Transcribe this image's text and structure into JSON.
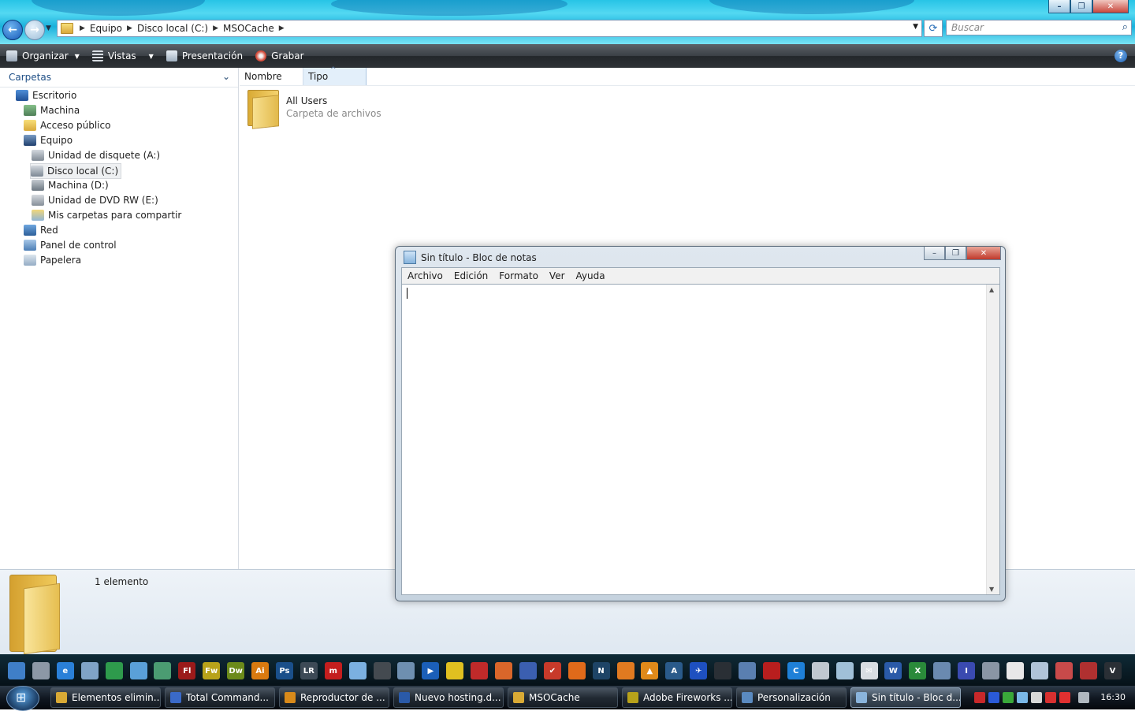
{
  "explorer": {
    "breadcrumb": [
      "Equipo",
      "Disco local (C:)",
      "MSOCache"
    ],
    "search_placeholder": "Buscar",
    "toolbar": {
      "organize": "Organizar",
      "views": "Vistas",
      "slideshow": "Presentación",
      "burn": "Grabar"
    },
    "folders_header": "Carpetas",
    "tree": [
      {
        "label": "Escritorio",
        "icon": "desktop-icon"
      },
      {
        "label": "Machina",
        "icon": "user-folder-icon"
      },
      {
        "label": "Acceso público",
        "icon": "folder-icon"
      },
      {
        "label": "Equipo",
        "icon": "computer-icon"
      },
      {
        "label": "Unidad de disquete (A:)",
        "icon": "floppy-drive-icon"
      },
      {
        "label": "Disco local (C:)",
        "icon": "hard-drive-icon",
        "selected": true
      },
      {
        "label": "Machina (D:)",
        "icon": "hard-drive-icon"
      },
      {
        "label": "Unidad de DVD RW (E:)",
        "icon": "dvd-drive-icon"
      },
      {
        "label": "Mis carpetas para compartir",
        "icon": "shared-folder-icon"
      },
      {
        "label": "Red",
        "icon": "network-icon"
      },
      {
        "label": "Panel de control",
        "icon": "control-panel-icon"
      },
      {
        "label": "Papelera",
        "icon": "recycle-bin-icon"
      }
    ],
    "columns": {
      "name": "Nombre",
      "type": "Tipo"
    },
    "items": [
      {
        "name": "All Users",
        "type": "Carpeta de archivos"
      }
    ],
    "status": "1 elemento"
  },
  "notepad": {
    "title": "Sin título - Bloc de notas",
    "menu": [
      "Archivo",
      "Edición",
      "Formato",
      "Ver",
      "Ayuda"
    ],
    "content": ""
  },
  "dock_icons": [
    {
      "name": "desktop-icon",
      "glyph": "",
      "color": "#3f7fc8"
    },
    {
      "name": "monitor-icon",
      "glyph": "",
      "color": "#8c98a6"
    },
    {
      "name": "internet-explorer-icon",
      "glyph": "e",
      "color": "#2a80d8"
    },
    {
      "name": "home-icon",
      "glyph": "",
      "color": "#7fa3c6"
    },
    {
      "name": "app-icon",
      "glyph": "",
      "color": "#2e9b4c"
    },
    {
      "name": "users-icon",
      "glyph": "",
      "color": "#5aa0d8"
    },
    {
      "name": "window-icon",
      "glyph": "",
      "color": "#4b9c72"
    },
    {
      "name": "flash-icon",
      "glyph": "Fl",
      "color": "#9b1a1a"
    },
    {
      "name": "fireworks-icon",
      "glyph": "Fw",
      "color": "#b8a21a"
    },
    {
      "name": "dreamweaver-icon",
      "glyph": "Dw",
      "color": "#6b8a1a"
    },
    {
      "name": "illustrator-icon",
      "glyph": "Ai",
      "color": "#d97a10"
    },
    {
      "name": "photoshop-icon",
      "glyph": "Ps",
      "color": "#1a4f8a"
    },
    {
      "name": "lightroom-icon",
      "glyph": "LR",
      "color": "#3d4a56"
    },
    {
      "name": "media-icon",
      "glyph": "m",
      "color": "#c41e1e"
    },
    {
      "name": "itunes-icon",
      "glyph": "",
      "color": "#7bb0e0"
    },
    {
      "name": "phone-icon",
      "glyph": "",
      "color": "#444a50"
    },
    {
      "name": "tools-icon",
      "glyph": "",
      "color": "#6e8fb0"
    },
    {
      "name": "player-icon",
      "glyph": "▶",
      "color": "#1b5fb8"
    },
    {
      "name": "norton-icon",
      "glyph": "",
      "color": "#e0c020"
    },
    {
      "name": "books-icon",
      "glyph": "",
      "color": "#c02a2a"
    },
    {
      "name": "cake-icon",
      "glyph": "",
      "color": "#d9662a"
    },
    {
      "name": "save-icon",
      "glyph": "",
      "color": "#3b5fb0"
    },
    {
      "name": "check-icon",
      "glyph": "✔",
      "color": "#c83a2a"
    },
    {
      "name": "firefox-icon",
      "glyph": "",
      "color": "#e06a1a"
    },
    {
      "name": "nero-icon",
      "glyph": "N",
      "color": "#1e4466"
    },
    {
      "name": "basketball-icon",
      "glyph": "",
      "color": "#e07a20"
    },
    {
      "name": "vlc-icon",
      "glyph": "▲",
      "color": "#e08a1a"
    },
    {
      "name": "a-icon",
      "glyph": "A",
      "color": "#2a5a8a"
    },
    {
      "name": "plane-icon",
      "glyph": "✈",
      "color": "#1e50c0"
    },
    {
      "name": "camera-icon",
      "glyph": "",
      "color": "#2a2f35"
    },
    {
      "name": "bars-icon",
      "glyph": "",
      "color": "#5a7fb0"
    },
    {
      "name": "acrobat-icon",
      "glyph": "",
      "color": "#b81e1e"
    },
    {
      "name": "c-icon",
      "glyph": "C",
      "color": "#1e80d8"
    },
    {
      "name": "card-icon",
      "glyph": "",
      "color": "#c0c8d0"
    },
    {
      "name": "paper-icon",
      "glyph": "",
      "color": "#a0c0d8"
    },
    {
      "name": "mail-icon",
      "glyph": "✉",
      "color": "#d8dde2"
    },
    {
      "name": "word-icon",
      "glyph": "W",
      "color": "#2a5aa8"
    },
    {
      "name": "excel-icon",
      "glyph": "X",
      "color": "#2a8a3a"
    },
    {
      "name": "photo-icon",
      "glyph": "",
      "color": "#6a8ab0"
    },
    {
      "name": "i-icon",
      "glyph": "I",
      "color": "#3a4ab0"
    },
    {
      "name": "pen-icon",
      "glyph": "",
      "color": "#8a96a4"
    },
    {
      "name": "cat-icon",
      "glyph": "",
      "color": "#e8e8e8"
    },
    {
      "name": "globe-icon",
      "glyph": "",
      "color": "#b0c4d8"
    },
    {
      "name": "cube-icon",
      "glyph": "",
      "color": "#c84a4a"
    },
    {
      "name": "ball-icon",
      "glyph": "",
      "color": "#b03030"
    },
    {
      "name": "v-icon",
      "glyph": "V",
      "color": "#2a2f35"
    }
  ],
  "taskbar": {
    "tasks": [
      {
        "label": "Elementos elimin...",
        "icon": "folder-icon",
        "color": "#d9aa35"
      },
      {
        "label": "Total Command...",
        "icon": "total-commander-icon",
        "color": "#3a6ac8"
      },
      {
        "label": "Reproductor de ...",
        "icon": "media-player-icon",
        "color": "#d98a1a"
      },
      {
        "label": "Nuevo hosting.d...",
        "icon": "word-icon",
        "color": "#2a5aa8"
      },
      {
        "label": "MSOCache",
        "icon": "folder-icon",
        "color": "#d9aa35"
      },
      {
        "label": "Adobe Fireworks ...",
        "icon": "fireworks-icon",
        "color": "#b8a21a"
      },
      {
        "label": "Personalización",
        "icon": "control-panel-icon",
        "color": "#5a8ac0"
      },
      {
        "label": "Sin título - Bloc d...",
        "icon": "notepad-icon",
        "color": "#8ab4dc",
        "active": true
      }
    ],
    "clock": "16:30"
  }
}
